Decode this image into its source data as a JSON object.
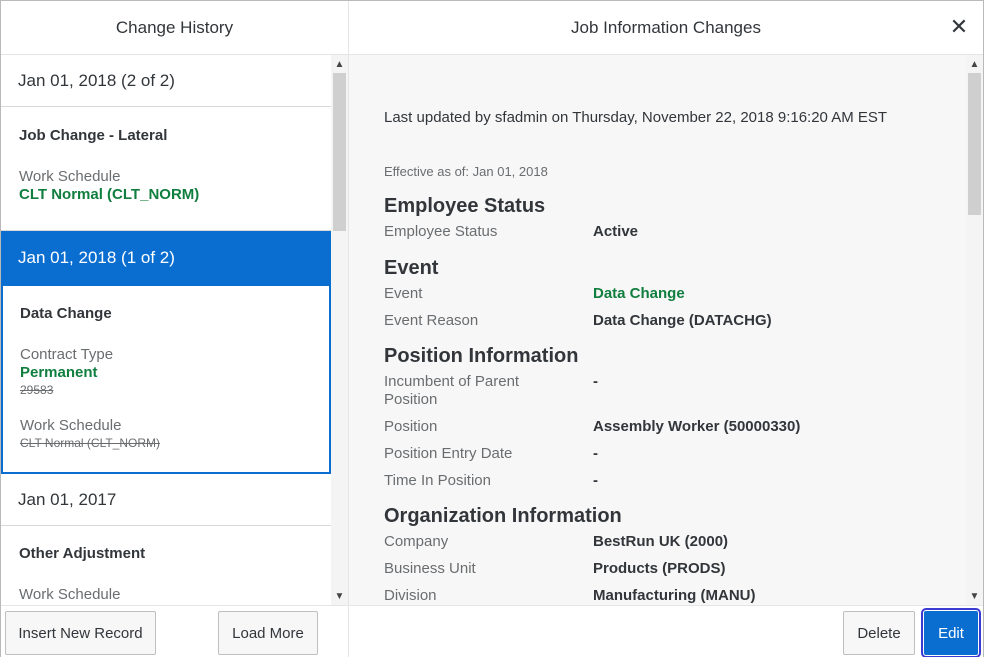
{
  "left": {
    "header": "Change History",
    "records": [
      {
        "date": "Jan 01, 2018 (2 of 2)",
        "title": "Job Change - Lateral",
        "fields": [
          {
            "label": "Work Schedule",
            "value": "CLT Normal (CLT_NORM)",
            "old": ""
          }
        ]
      },
      {
        "date": "Jan 01, 2018 (1 of 2)",
        "title": "Data Change",
        "fields": [
          {
            "label": "Contract Type",
            "value": "Permanent",
            "old": "29583"
          },
          {
            "label": "Work Schedule",
            "value": "",
            "old": "CLT Normal (CLT_NORM)"
          }
        ]
      },
      {
        "date": "Jan 01, 2017",
        "title": "Other Adjustment",
        "fields": [
          {
            "label": "Work Schedule",
            "value": "",
            "old": ""
          }
        ]
      }
    ],
    "buttons": {
      "insert": "Insert New Record",
      "load_more": "Load More"
    }
  },
  "right": {
    "header": "Job Information Changes",
    "close_icon": "close-icon",
    "updated": "Last updated by sfadmin on Thursday, November 22, 2018 9:16:20 AM EST",
    "effective": "Effective as of: Jan 01, 2018",
    "sections": [
      {
        "title": "Employee Status",
        "fields": [
          {
            "label": "Employee Status",
            "value": "Active"
          }
        ]
      },
      {
        "title": "Event",
        "fields": [
          {
            "label": "Event",
            "value": "Data Change"
          },
          {
            "label": "Event Reason",
            "value": "Data Change (DATACHG)"
          }
        ]
      },
      {
        "title": "Position Information",
        "fields": [
          {
            "label": "Incumbent of Parent Position",
            "value": "-"
          },
          {
            "label": "Position",
            "value": "Assembly Worker (50000330)"
          },
          {
            "label": "Position Entry Date",
            "value": "-"
          },
          {
            "label": "Time In Position",
            "value": "-"
          }
        ]
      },
      {
        "title": "Organization Information",
        "fields": [
          {
            "label": "Company",
            "value": "BestRun UK (2000)"
          },
          {
            "label": "Business Unit",
            "value": "Products (PRODS)"
          },
          {
            "label": "Division",
            "value": "Manufacturing (MANU)"
          }
        ]
      }
    ],
    "buttons": {
      "delete": "Delete",
      "edit": "Edit"
    }
  },
  "colors": {
    "accent": "#0a6ed1",
    "positive": "#107e3e"
  }
}
